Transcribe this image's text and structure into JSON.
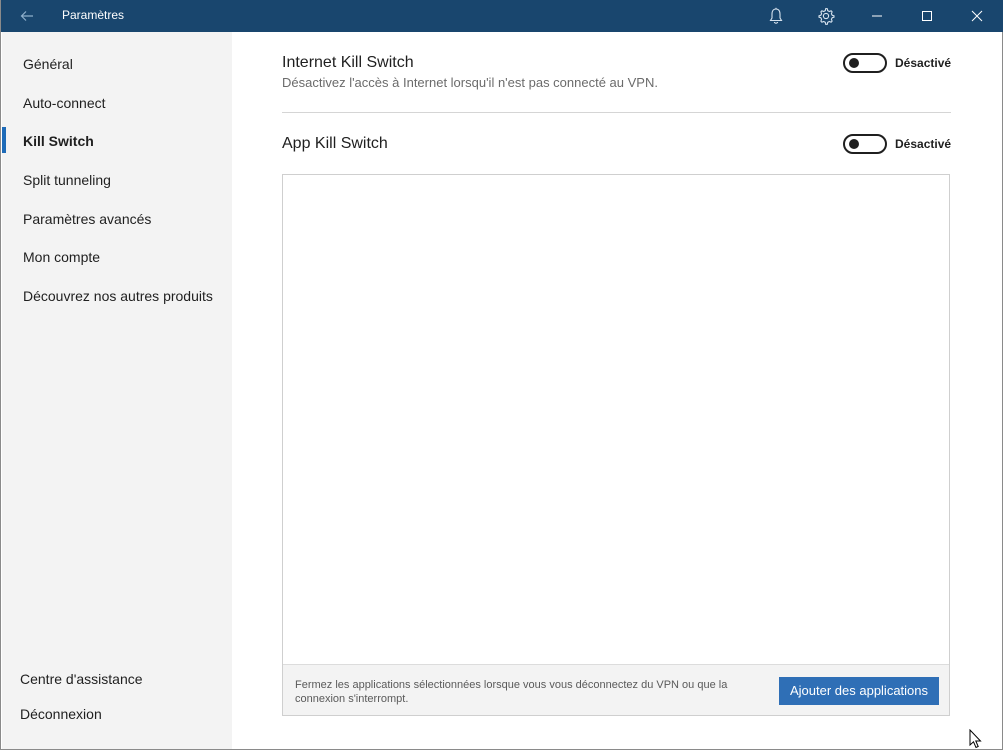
{
  "window": {
    "title": "Paramètres"
  },
  "icons": {
    "back": "back-arrow-icon",
    "notifications": "bell-icon",
    "settings": "gear-icon",
    "minimize": "minimize-icon",
    "maximize": "maximize-icon",
    "close": "close-icon"
  },
  "colors": {
    "titlebar": "#19466e",
    "accent": "#1e6bb8",
    "button": "#2f6fb6",
    "sidebar": "#f3f3f3"
  },
  "sidebar": {
    "items": [
      {
        "label": "Général",
        "active": false
      },
      {
        "label": "Auto-connect",
        "active": false
      },
      {
        "label": "Kill Switch",
        "active": true
      },
      {
        "label": "Split tunneling",
        "active": false
      },
      {
        "label": "Paramètres avancés",
        "active": false
      },
      {
        "label": "Mon compte",
        "active": false
      },
      {
        "label": "Découvrez nos autres produits",
        "active": false
      }
    ],
    "bottom_items": [
      {
        "label": "Centre d'assistance"
      },
      {
        "label": "Déconnexion"
      }
    ]
  },
  "internet_kill_switch": {
    "title": "Internet Kill Switch",
    "description": "Désactivez l'accès à Internet lorsqu'il n'est pas connecté au VPN.",
    "state_label": "Désactivé",
    "enabled": false
  },
  "app_kill_switch": {
    "title": "App Kill Switch",
    "state_label": "Désactivé",
    "enabled": false,
    "applications": [],
    "footer_text": "Fermez les applications sélectionnées lorsque vous vous déconnectez du VPN ou que la connexion s'interrompt.",
    "add_button_label": "Ajouter des applications"
  }
}
